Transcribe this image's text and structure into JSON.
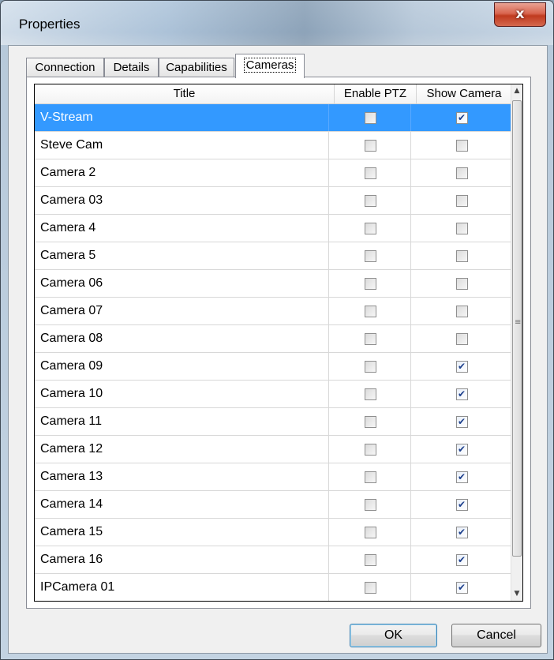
{
  "window": {
    "title": "Properties",
    "close_glyph": "x"
  },
  "tabs": [
    {
      "label": "Connection"
    },
    {
      "label": "Details"
    },
    {
      "label": "Capabilities"
    },
    {
      "label": "Cameras"
    }
  ],
  "active_tab": "Cameras",
  "grid": {
    "columns": [
      "Title",
      "Enable PTZ",
      "Show Camera"
    ],
    "rows": [
      {
        "title": "V-Stream",
        "ptz": false,
        "show": true,
        "selected": true
      },
      {
        "title": "Steve Cam",
        "ptz": false,
        "show": false
      },
      {
        "title": "Camera 2",
        "ptz": false,
        "show": false
      },
      {
        "title": "Camera 03",
        "ptz": false,
        "show": false
      },
      {
        "title": "Camera 4",
        "ptz": false,
        "show": false
      },
      {
        "title": "Camera 5",
        "ptz": false,
        "show": false
      },
      {
        "title": "Camera 06",
        "ptz": false,
        "show": false
      },
      {
        "title": "Camera 07",
        "ptz": false,
        "show": false
      },
      {
        "title": "Camera 08",
        "ptz": false,
        "show": false
      },
      {
        "title": "Camera 09",
        "ptz": false,
        "show": true
      },
      {
        "title": "Camera 10",
        "ptz": false,
        "show": true
      },
      {
        "title": "Camera 11",
        "ptz": false,
        "show": true
      },
      {
        "title": "Camera 12",
        "ptz": false,
        "show": true
      },
      {
        "title": "Camera 13",
        "ptz": false,
        "show": true
      },
      {
        "title": "Camera 14",
        "ptz": false,
        "show": true
      },
      {
        "title": "Camera 15",
        "ptz": false,
        "show": true
      },
      {
        "title": "Camera 16",
        "ptz": false,
        "show": true
      },
      {
        "title": "IPCamera 01",
        "ptz": false,
        "show": true
      }
    ]
  },
  "buttons": {
    "ok": "OK",
    "cancel": "Cancel"
  },
  "icons": {
    "scroll_up": "chevron-up-icon",
    "scroll_down": "chevron-down-icon",
    "check": "checkmark-icon"
  },
  "colors": {
    "selection": "#3399ff",
    "close_button": "#c8432a"
  }
}
